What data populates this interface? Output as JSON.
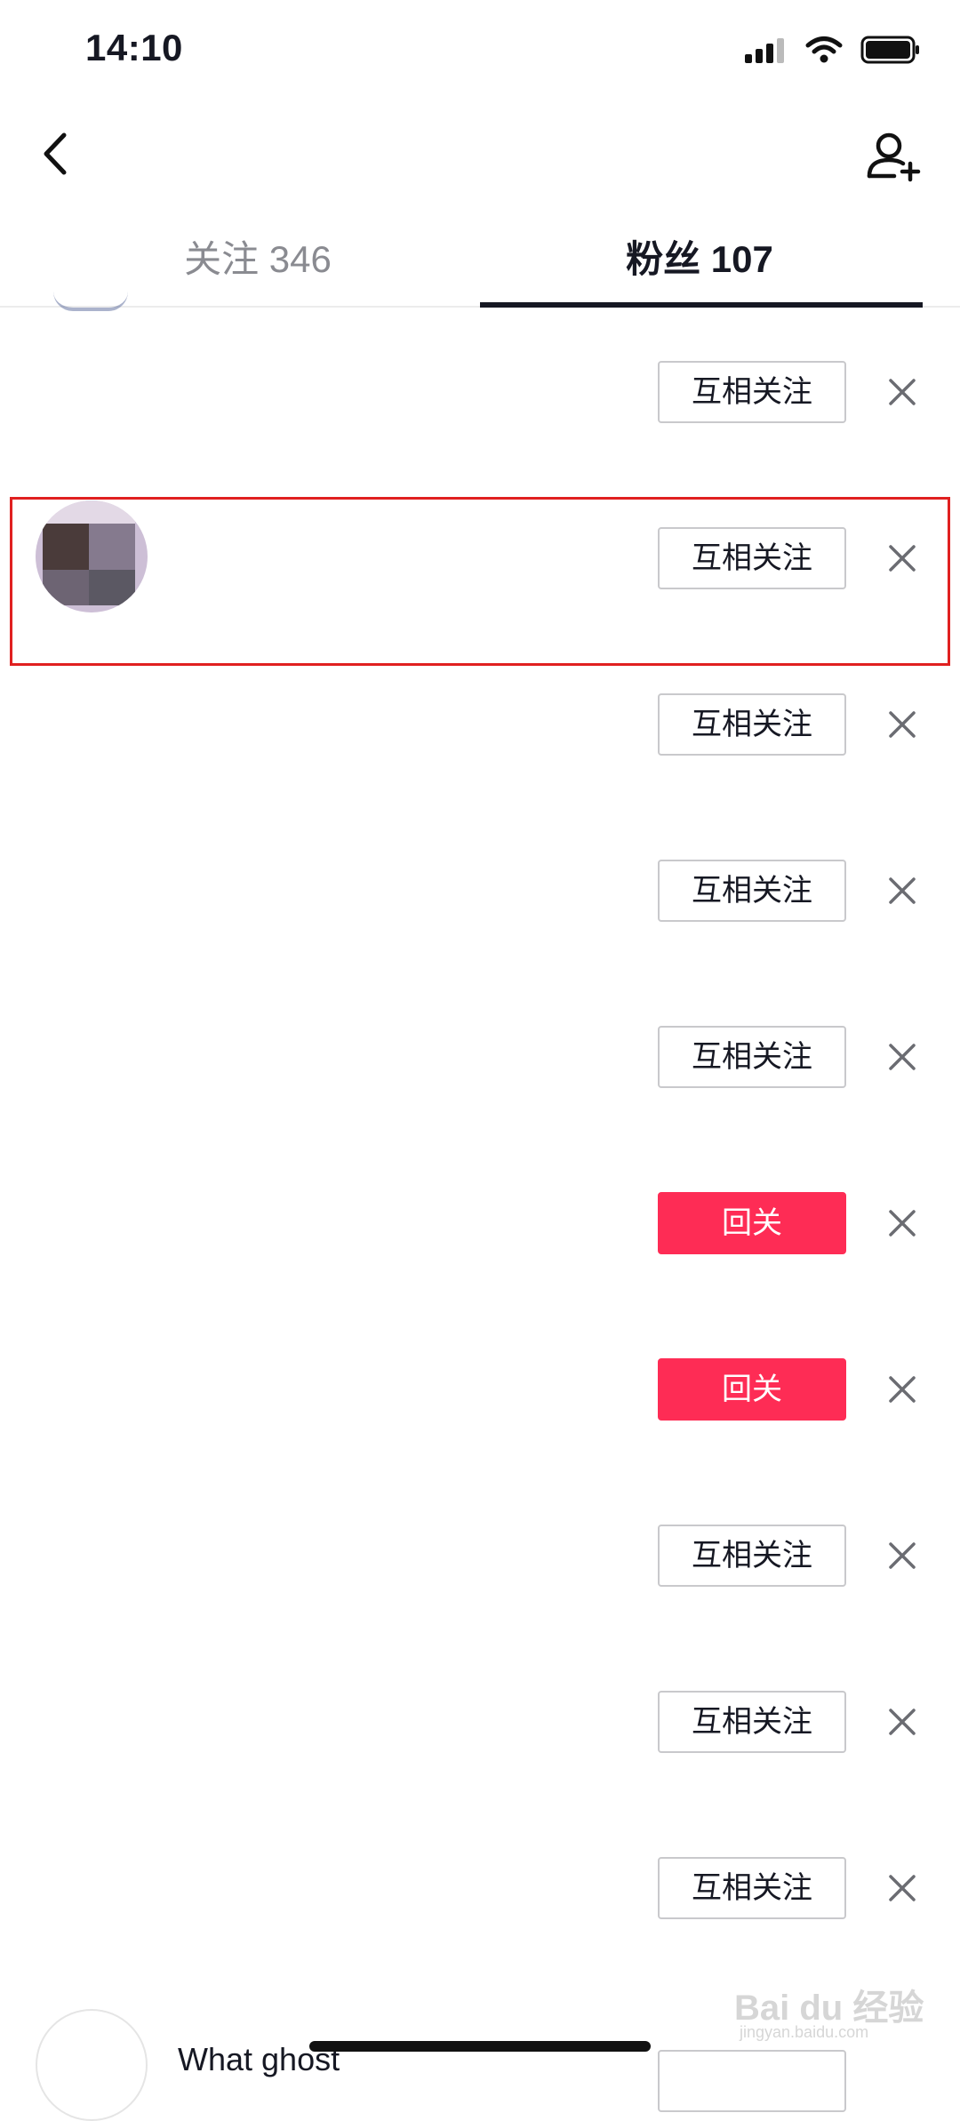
{
  "status_bar": {
    "time": "14:10"
  },
  "tabs": [
    {
      "label": "关注 346",
      "active": false
    },
    {
      "label": "粉丝 107",
      "active": true
    }
  ],
  "rows": [
    {
      "button": "互相关注",
      "primary": false
    },
    {
      "button": "互相关注",
      "primary": false,
      "has_avatar": true,
      "highlighted": true
    },
    {
      "button": "互相关注",
      "primary": false
    },
    {
      "button": "互相关注",
      "primary": false
    },
    {
      "button": "互相关注",
      "primary": false
    },
    {
      "button": "回关",
      "primary": true
    },
    {
      "button": "回关",
      "primary": true
    },
    {
      "button": "互相关注",
      "primary": false
    },
    {
      "button": "互相关注",
      "primary": false
    },
    {
      "button": "互相关注",
      "primary": false
    }
  ],
  "partial_row": {
    "name": "What ghost"
  },
  "watermark": {
    "text": "Bai du 经验",
    "sub": "jingyan.baidu.com"
  },
  "colors": {
    "accent": "#fe2c55",
    "highlight": "#e02020",
    "text": "#161823"
  },
  "icons": {
    "back": "chevron-left-icon",
    "add_friend": "add-user-icon",
    "close": "close-icon"
  }
}
